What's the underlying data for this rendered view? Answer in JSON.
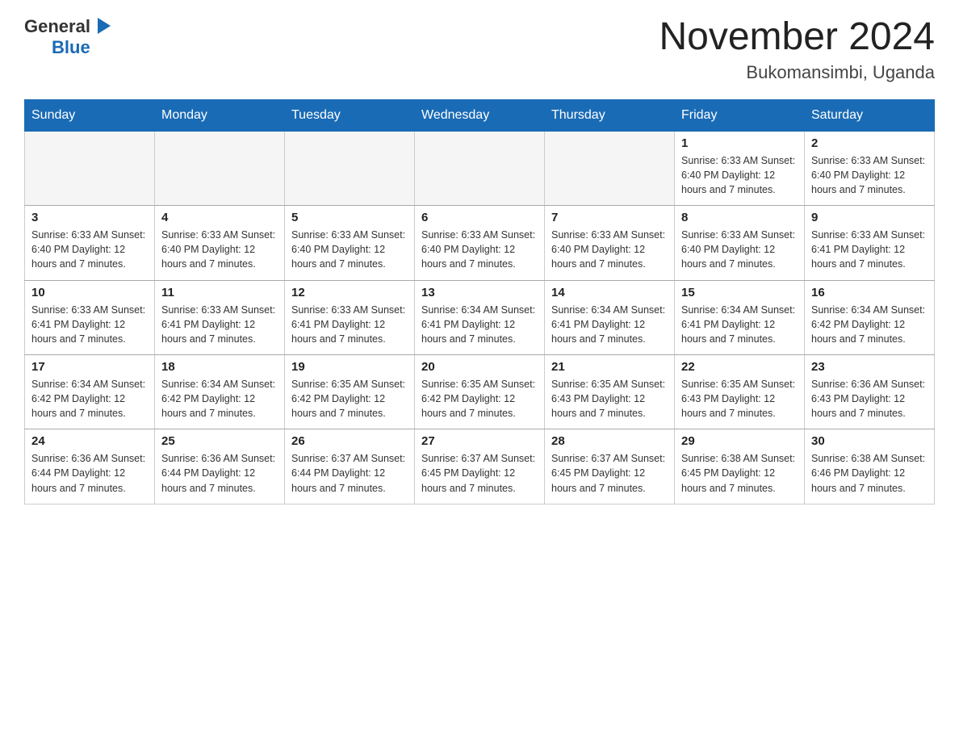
{
  "header": {
    "logo": {
      "general": "General",
      "blue": "Blue"
    },
    "title": "November 2024",
    "subtitle": "Bukomansimbi, Uganda"
  },
  "calendar": {
    "days_of_week": [
      "Sunday",
      "Monday",
      "Tuesday",
      "Wednesday",
      "Thursday",
      "Friday",
      "Saturday"
    ],
    "weeks": [
      [
        {
          "day": "",
          "info": ""
        },
        {
          "day": "",
          "info": ""
        },
        {
          "day": "",
          "info": ""
        },
        {
          "day": "",
          "info": ""
        },
        {
          "day": "",
          "info": ""
        },
        {
          "day": "1",
          "info": "Sunrise: 6:33 AM\nSunset: 6:40 PM\nDaylight: 12 hours and 7 minutes."
        },
        {
          "day": "2",
          "info": "Sunrise: 6:33 AM\nSunset: 6:40 PM\nDaylight: 12 hours and 7 minutes."
        }
      ],
      [
        {
          "day": "3",
          "info": "Sunrise: 6:33 AM\nSunset: 6:40 PM\nDaylight: 12 hours and 7 minutes."
        },
        {
          "day": "4",
          "info": "Sunrise: 6:33 AM\nSunset: 6:40 PM\nDaylight: 12 hours and 7 minutes."
        },
        {
          "day": "5",
          "info": "Sunrise: 6:33 AM\nSunset: 6:40 PM\nDaylight: 12 hours and 7 minutes."
        },
        {
          "day": "6",
          "info": "Sunrise: 6:33 AM\nSunset: 6:40 PM\nDaylight: 12 hours and 7 minutes."
        },
        {
          "day": "7",
          "info": "Sunrise: 6:33 AM\nSunset: 6:40 PM\nDaylight: 12 hours and 7 minutes."
        },
        {
          "day": "8",
          "info": "Sunrise: 6:33 AM\nSunset: 6:40 PM\nDaylight: 12 hours and 7 minutes."
        },
        {
          "day": "9",
          "info": "Sunrise: 6:33 AM\nSunset: 6:41 PM\nDaylight: 12 hours and 7 minutes."
        }
      ],
      [
        {
          "day": "10",
          "info": "Sunrise: 6:33 AM\nSunset: 6:41 PM\nDaylight: 12 hours and 7 minutes."
        },
        {
          "day": "11",
          "info": "Sunrise: 6:33 AM\nSunset: 6:41 PM\nDaylight: 12 hours and 7 minutes."
        },
        {
          "day": "12",
          "info": "Sunrise: 6:33 AM\nSunset: 6:41 PM\nDaylight: 12 hours and 7 minutes."
        },
        {
          "day": "13",
          "info": "Sunrise: 6:34 AM\nSunset: 6:41 PM\nDaylight: 12 hours and 7 minutes."
        },
        {
          "day": "14",
          "info": "Sunrise: 6:34 AM\nSunset: 6:41 PM\nDaylight: 12 hours and 7 minutes."
        },
        {
          "day": "15",
          "info": "Sunrise: 6:34 AM\nSunset: 6:41 PM\nDaylight: 12 hours and 7 minutes."
        },
        {
          "day": "16",
          "info": "Sunrise: 6:34 AM\nSunset: 6:42 PM\nDaylight: 12 hours and 7 minutes."
        }
      ],
      [
        {
          "day": "17",
          "info": "Sunrise: 6:34 AM\nSunset: 6:42 PM\nDaylight: 12 hours and 7 minutes."
        },
        {
          "day": "18",
          "info": "Sunrise: 6:34 AM\nSunset: 6:42 PM\nDaylight: 12 hours and 7 minutes."
        },
        {
          "day": "19",
          "info": "Sunrise: 6:35 AM\nSunset: 6:42 PM\nDaylight: 12 hours and 7 minutes."
        },
        {
          "day": "20",
          "info": "Sunrise: 6:35 AM\nSunset: 6:42 PM\nDaylight: 12 hours and 7 minutes."
        },
        {
          "day": "21",
          "info": "Sunrise: 6:35 AM\nSunset: 6:43 PM\nDaylight: 12 hours and 7 minutes."
        },
        {
          "day": "22",
          "info": "Sunrise: 6:35 AM\nSunset: 6:43 PM\nDaylight: 12 hours and 7 minutes."
        },
        {
          "day": "23",
          "info": "Sunrise: 6:36 AM\nSunset: 6:43 PM\nDaylight: 12 hours and 7 minutes."
        }
      ],
      [
        {
          "day": "24",
          "info": "Sunrise: 6:36 AM\nSunset: 6:44 PM\nDaylight: 12 hours and 7 minutes."
        },
        {
          "day": "25",
          "info": "Sunrise: 6:36 AM\nSunset: 6:44 PM\nDaylight: 12 hours and 7 minutes."
        },
        {
          "day": "26",
          "info": "Sunrise: 6:37 AM\nSunset: 6:44 PM\nDaylight: 12 hours and 7 minutes."
        },
        {
          "day": "27",
          "info": "Sunrise: 6:37 AM\nSunset: 6:45 PM\nDaylight: 12 hours and 7 minutes."
        },
        {
          "day": "28",
          "info": "Sunrise: 6:37 AM\nSunset: 6:45 PM\nDaylight: 12 hours and 7 minutes."
        },
        {
          "day": "29",
          "info": "Sunrise: 6:38 AM\nSunset: 6:45 PM\nDaylight: 12 hours and 7 minutes."
        },
        {
          "day": "30",
          "info": "Sunrise: 6:38 AM\nSunset: 6:46 PM\nDaylight: 12 hours and 7 minutes."
        }
      ]
    ]
  }
}
